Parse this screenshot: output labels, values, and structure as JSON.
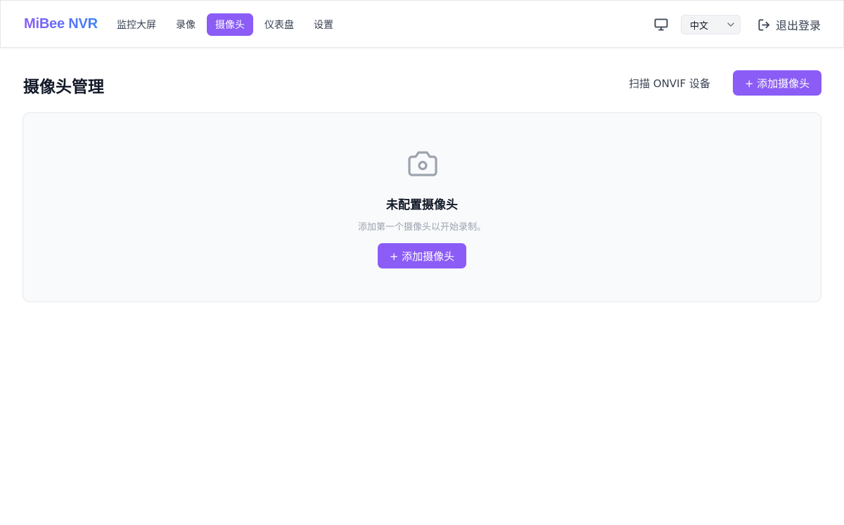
{
  "header": {
    "brand": "MiBee NVR",
    "nav": [
      {
        "label": "监控大屏",
        "active": false
      },
      {
        "label": "录像",
        "active": false
      },
      {
        "label": "摄像头",
        "active": true
      },
      {
        "label": "仪表盘",
        "active": false
      },
      {
        "label": "设置",
        "active": false
      }
    ],
    "monitor_icon": "monitor-icon",
    "language": {
      "selected": "中文"
    },
    "logout_label": "退出登录"
  },
  "page": {
    "title": "摄像头管理",
    "scan_label": "扫描 ONVIF 设备",
    "add_label": "+ 添加摄像头"
  },
  "empty_state": {
    "icon": "camera-icon",
    "title": "未配置摄像头",
    "subtitle": "添加第一个摄像头以开始录制。",
    "add_label": "+ 添加摄像头"
  },
  "colors": {
    "accent": "#8b5cf6",
    "brand_gradient_end": "#3b82f6",
    "panel_bg": "#f9fafb",
    "muted_text": "#9ca3af"
  }
}
